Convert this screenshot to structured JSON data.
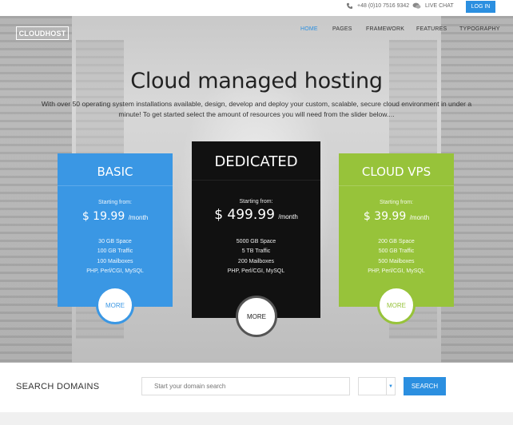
{
  "topbar": {
    "phone": "+48 (0)10 7516 9342",
    "live_chat": "LIVE CHAT",
    "login": "LOG IN"
  },
  "brand": {
    "logo": "CLOUDHOST"
  },
  "nav": {
    "items": [
      "HOME",
      "PAGES",
      "FRAMEWORK",
      "FEATURES",
      "TYPOGRAPHY"
    ],
    "active": "HOME"
  },
  "hero": {
    "headline": "Cloud managed hosting",
    "subline": "With over 50 operating system installations available, design, develop and deploy your custom, scalable, secure cloud environment in under a minute! To get started select the amount of resources you will need from the slider below...."
  },
  "plans": [
    {
      "name": "BASIC",
      "starting_from": "Starting from:",
      "price": "$ 19.99",
      "period": "/month",
      "features": [
        "30 GB Space",
        "100 GB Traffic",
        "100 Mailboxes",
        "PHP, Perl/CGI, MySQL"
      ],
      "more": "MORE",
      "color": "#3a97e4"
    },
    {
      "name": "DEDICATED",
      "starting_from": "Starting from:",
      "price": "$ 499.99",
      "period": "/month",
      "features": [
        "5000 GB Space",
        "5 TB Traffic",
        "200 Mailboxes",
        "PHP, Perl/CGI, MySQL"
      ],
      "more": "MORE",
      "color": "#111111"
    },
    {
      "name": "CLOUD VPS",
      "starting_from": "Starting from:",
      "price": "$ 39.99",
      "period": "/month",
      "features": [
        "200 GB Space",
        "500 GB Traffic",
        "500 Mailboxes",
        "PHP, Perl/CGI, MySQL"
      ],
      "more": "MORE",
      "color": "#97c33a"
    }
  ],
  "domain_search": {
    "title": "SEARCH DOMAINS",
    "placeholder": "Start your domain search",
    "tld_value": "",
    "button": "SEARCH"
  },
  "colors": {
    "accent": "#2b8fe0",
    "basic": "#3a97e4",
    "dedicated": "#111111",
    "vps": "#97c33a"
  },
  "icons": [
    "phone-icon",
    "chat-icon",
    "caret-down-icon"
  ]
}
